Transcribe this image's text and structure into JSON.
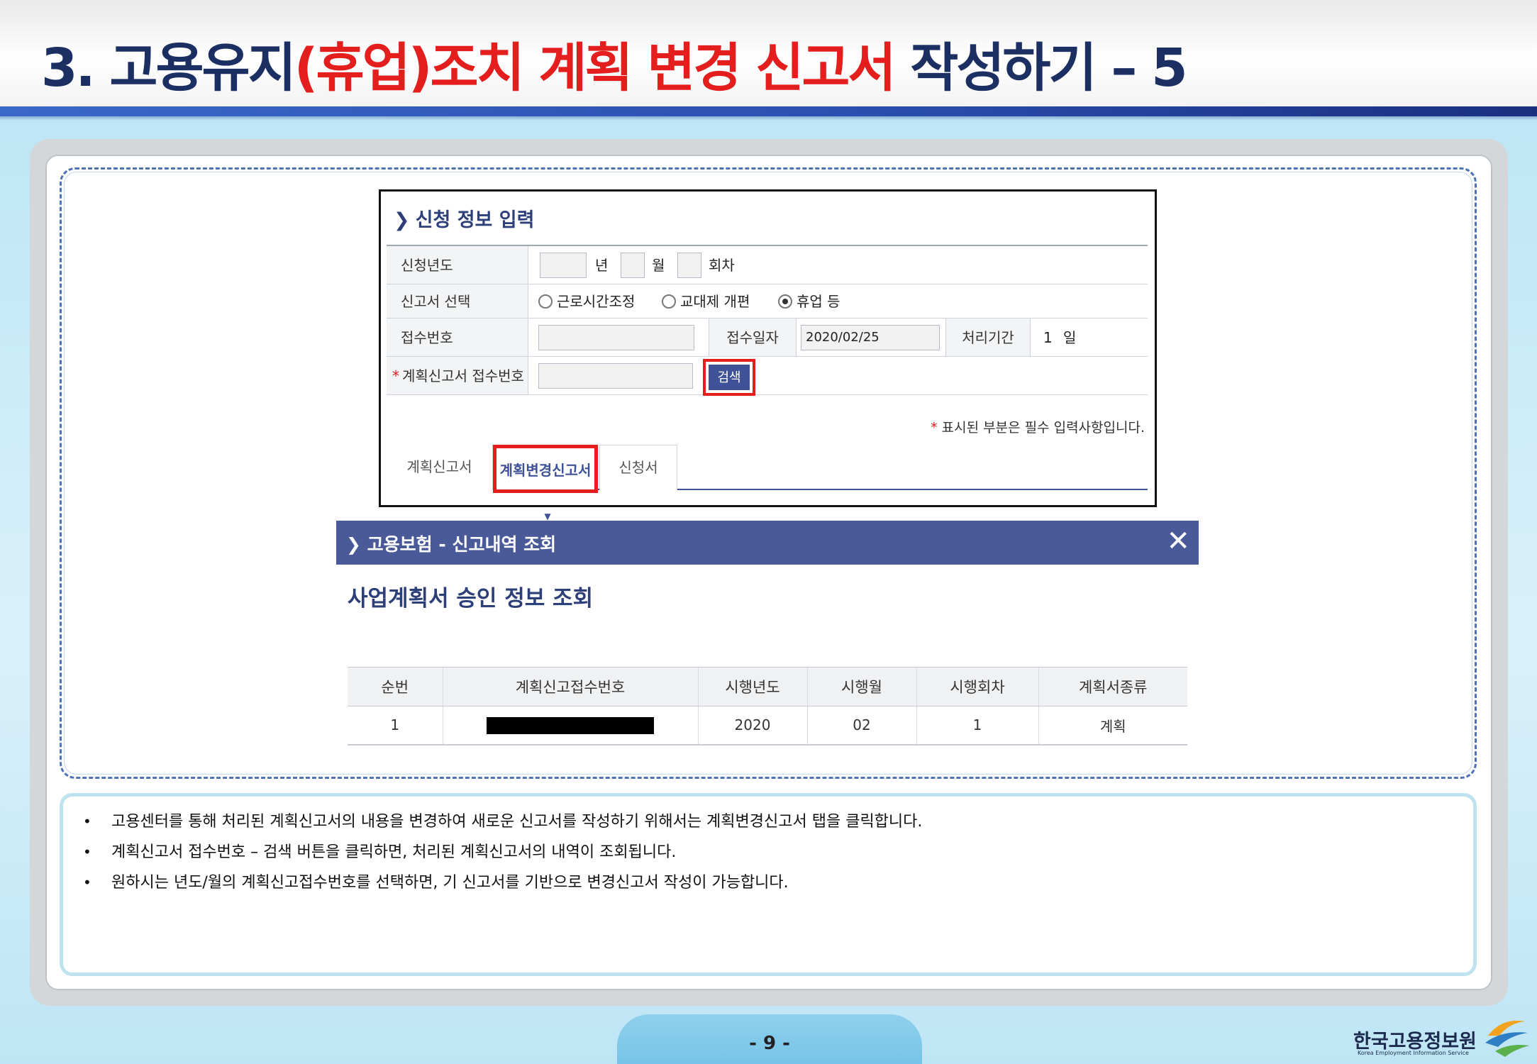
{
  "slide": {
    "title_prefix": "3. 고용유지",
    "title_highlight": "(휴업)조치 계획 변경 신고서",
    "title_suffix": " 작성하기 – 5",
    "page_number": "- 9 -"
  },
  "form_panel": {
    "heading": "신청 정보 입력",
    "rows": {
      "year_label": "신청년도",
      "year_unit": "년",
      "month_unit": "월",
      "round_unit": "회차",
      "report_type_label": "신고서 선택",
      "options": [
        "근로시간조정",
        "교대제 개편",
        "휴업 등"
      ],
      "selected_option": "휴업 등",
      "receipt_no_label": "접수번호",
      "receipt_date_label": "접수일자",
      "receipt_date_value": "2020/02/25",
      "processing_label": "처리기간",
      "processing_value": "1",
      "processing_unit": "일",
      "plan_receipt_label": "계획신고서 접수번호",
      "search_button": "검색"
    },
    "required_note": "표시된 부분은 필수 입력사항입니다.",
    "tabs": [
      "계획신고서",
      "계획변경신고서",
      "신청서"
    ],
    "active_tab": "계획변경신고서"
  },
  "dialog": {
    "title": "고용보험 - 신고내역 조회",
    "heading": "사업계획서 승인 정보 조회",
    "table": {
      "columns": [
        "순번",
        "계획신고접수번호",
        "시행년도",
        "시행월",
        "시행회차",
        "계획서종류"
      ],
      "rows": [
        {
          "seq": "1",
          "receipt_no": "",
          "year": "2020",
          "month": "02",
          "round": "1",
          "type": "계획"
        }
      ]
    }
  },
  "notes": [
    "고용센터를 통해 처리된 계획신고서의 내용을 변경하여 새로운 신고서를 작성하기 위해서는 계획변경신고서 탭을 클릭합니다.",
    "계획신고서 접수번호 – 검색 버튼을 클릭하면, 처리된 계획신고서의 내역이 조회됩니다.",
    "원하시는 년도/월의 계획신고접수번호를 선택하면, 기 신고서를 기반으로 변경신고서 작성이 가능합니다."
  ],
  "logo": {
    "name_ko": "한국고용정보원",
    "name_en": "Korea Employment Information Service"
  },
  "colors": {
    "title_navy": "#1b2f63",
    "title_red": "#e41d1d",
    "dialog_bar": "#4a5a99",
    "highlight_red": "#e41d1d"
  }
}
